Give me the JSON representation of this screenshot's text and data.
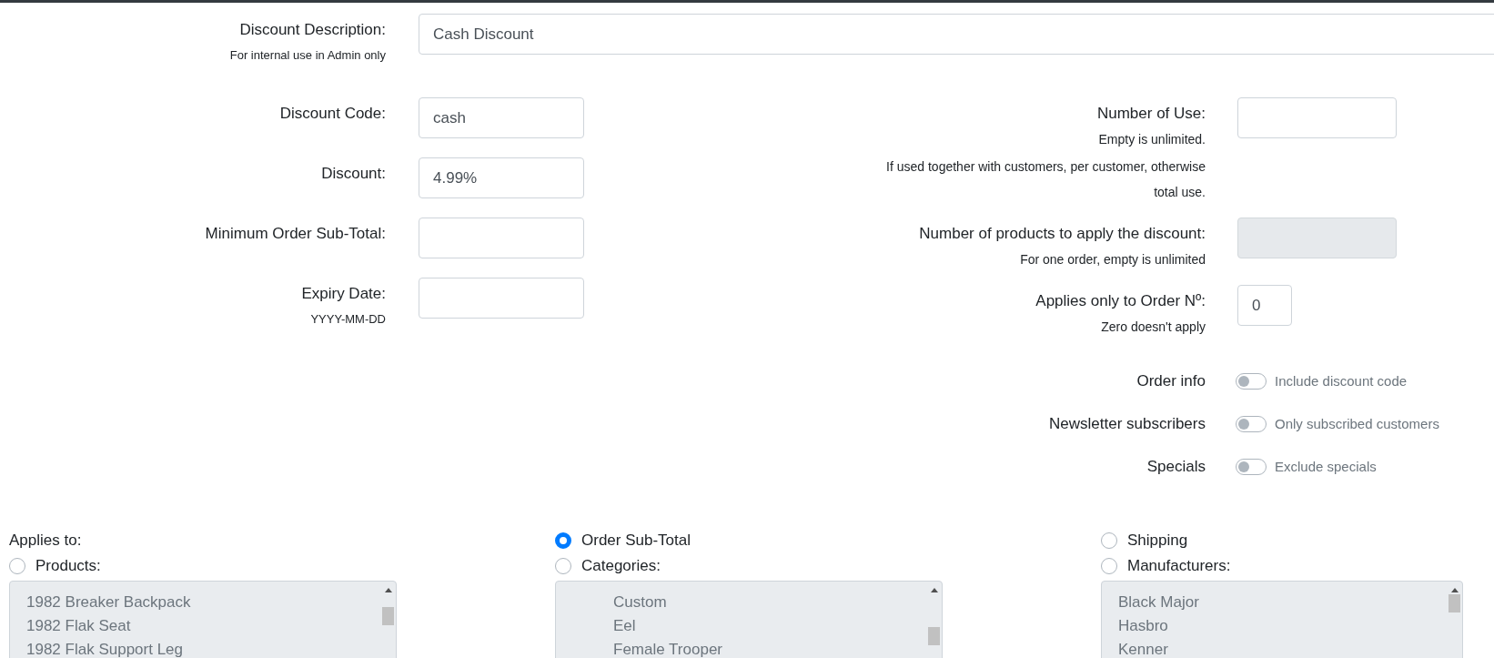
{
  "description": {
    "label": "Discount Description:",
    "help": "For internal use in Admin only",
    "value": "Cash Discount"
  },
  "left_fields": [
    {
      "label": "Discount Code:",
      "value": "cash",
      "disabled": false
    },
    {
      "label": "Discount:",
      "value": "4.99%",
      "disabled": false
    },
    {
      "label": "Minimum Order Sub-Total:",
      "disabled": false
    },
    {
      "label": "Expiry Date:",
      "help": [
        "YYYY-MM-DD"
      ],
      "disabled": false
    }
  ],
  "right_fields": [
    {
      "label": "Number of Use:",
      "help": [
        "Empty is unlimited.",
        "If used together with customers, per customer, otherwise total use."
      ],
      "disabled": false
    },
    {
      "label": "Number of products to apply the discount:",
      "help": [
        "For one order, empty is unlimited"
      ],
      "disabled": true
    },
    {
      "label": "Applies only to Order Nº:",
      "help": [
        "Zero doesn't apply"
      ],
      "value": "0",
      "disabled": false
    }
  ],
  "switches": [
    {
      "label": "Order info",
      "text": "Include discount code",
      "on": false
    },
    {
      "label": "Newsletter subscribers",
      "text": "Only subscribed customers",
      "on": false
    },
    {
      "label": "Specials",
      "text": "Exclude specials",
      "on": false
    }
  ],
  "applies_to": {
    "label": "Applies to:",
    "columns": [
      {
        "option": {
          "label": "Products:",
          "selected": false
        },
        "items": [
          {
            "label": "1982 Breaker Backpack",
            "indented": false
          },
          {
            "label": "1982 Flak Seat",
            "indented": false
          },
          {
            "label": "1982 Flak Support Leg",
            "indented": false
          }
        ]
      },
      {
        "top_option": {
          "label": "Order Sub-Total",
          "selected": true
        },
        "option": {
          "label": "Categories:",
          "selected": false
        },
        "items": [
          {
            "label": "Custom",
            "indented": true
          },
          {
            "label": "Eel",
            "indented": true
          },
          {
            "label": "Female Trooper",
            "indented": true
          }
        ]
      },
      {
        "top_option": {
          "label": "Shipping",
          "selected": false
        },
        "option": {
          "label": "Manufacturers:",
          "selected": false
        },
        "items": [
          {
            "label": "Black Major",
            "indented": false
          },
          {
            "label": "Hasbro",
            "indented": false
          },
          {
            "label": "Kenner",
            "indented": false
          }
        ]
      }
    ]
  }
}
